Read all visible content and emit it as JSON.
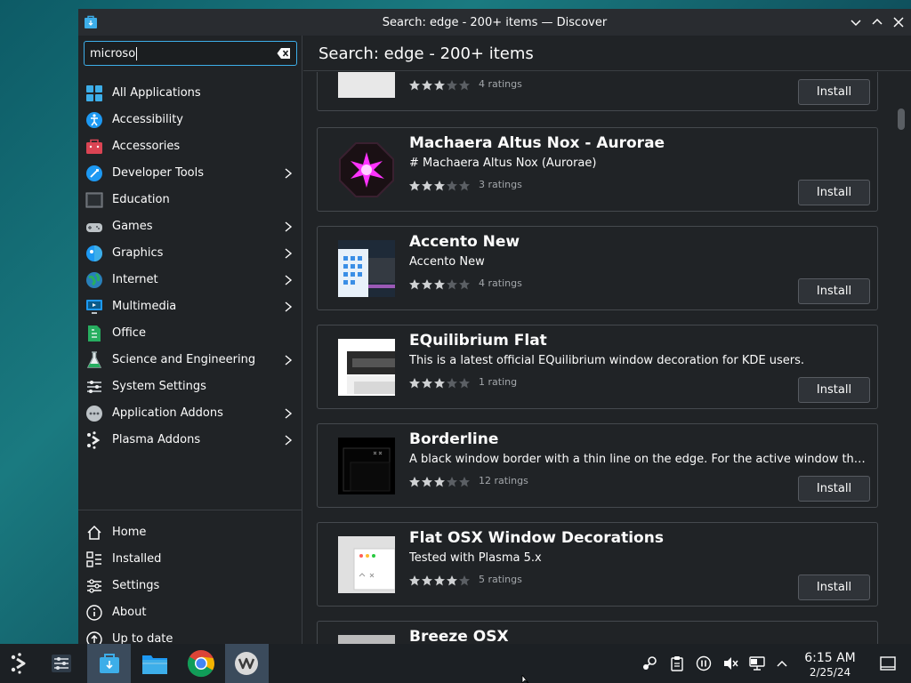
{
  "window": {
    "title": "Search: edge - 200+ items — Discover"
  },
  "search": {
    "value": "microso"
  },
  "categories": [
    {
      "label": "All Applications",
      "has_children": false
    },
    {
      "label": "Accessibility",
      "has_children": false
    },
    {
      "label": "Accessories",
      "has_children": false
    },
    {
      "label": "Developer Tools",
      "has_children": true
    },
    {
      "label": "Education",
      "has_children": false
    },
    {
      "label": "Games",
      "has_children": true
    },
    {
      "label": "Graphics",
      "has_children": true
    },
    {
      "label": "Internet",
      "has_children": true
    },
    {
      "label": "Multimedia",
      "has_children": true
    },
    {
      "label": "Office",
      "has_children": false
    },
    {
      "label": "Science and Engineering",
      "has_children": true
    },
    {
      "label": "System Settings",
      "has_children": false
    },
    {
      "label": "Application Addons",
      "has_children": true
    },
    {
      "label": "Plasma Addons",
      "has_children": true
    }
  ],
  "nav": [
    {
      "label": "Home",
      "icon": "home-icon"
    },
    {
      "label": "Installed",
      "icon": "installed-icon"
    },
    {
      "label": "Settings",
      "icon": "settings-icon"
    },
    {
      "label": "About",
      "icon": "info-icon"
    },
    {
      "label": "Up to date",
      "icon": "update-icon"
    }
  ],
  "main": {
    "heading": "Search: edge - 200+ items"
  },
  "results": [
    {
      "name": "",
      "description": "",
      "stars": 3,
      "ratings": "4 ratings",
      "install": "Install"
    },
    {
      "name": "Machaera Altus Nox - Aurorae",
      "description": "# Machaera Altus Nox (Aurorae)",
      "stars": 3,
      "ratings": "3 ratings",
      "install": "Install"
    },
    {
      "name": "Accento New",
      "description": "Accento New",
      "stars": 3,
      "ratings": "4 ratings",
      "install": "Install"
    },
    {
      "name": "EQuilibrium Flat",
      "description": "This is a latest official EQuilibrium window decoration for KDE users.",
      "stars": 3,
      "ratings": "1 rating",
      "install": "Install"
    },
    {
      "name": "Borderline",
      "description": "A black window border with a thin line on the edge. For the active window the line i...",
      "stars": 3,
      "ratings": "12 ratings",
      "install": "Install"
    },
    {
      "name": "Flat OSX Window Decorations",
      "description": "Tested with Plasma 5.x",
      "stars": 4,
      "ratings": "5 ratings",
      "install": "Install"
    },
    {
      "name": "Breeze OSX",
      "description": "",
      "stars": 0,
      "ratings": "",
      "install": ""
    }
  ],
  "taskbar": {
    "time": "6:15 AM",
    "date": "2/25/24"
  },
  "colors": {
    "accent": "#3daee9",
    "window_bg": "#202326",
    "star_filled": "#cfd1d3",
    "star_empty": "#5b5f64"
  }
}
